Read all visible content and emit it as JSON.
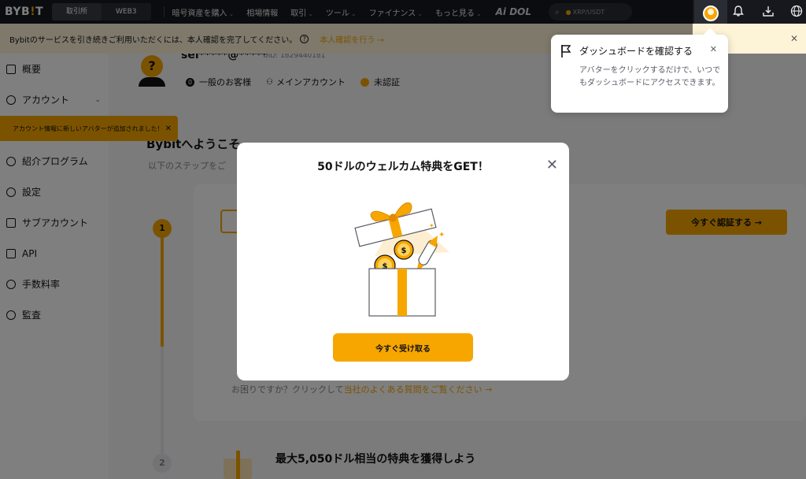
{
  "nav": {
    "logo_prefix": "BYB",
    "logo_i": "!",
    "logo_suffix": "T",
    "tabs": [
      "取引所",
      "WEB3"
    ],
    "menu": [
      "暗号資産を購入",
      "相場情報",
      "取引",
      "ツール",
      "ファイナンス",
      "もっと見る"
    ],
    "aidol": "Ai DOL",
    "search_placeholder": "XRP/USDT"
  },
  "banner": {
    "text": "Bybitのサービスを引き続きご利用いただくには、本人確認を完了してください。",
    "help": "?",
    "link": "本人確認を行う →",
    "close": "✕"
  },
  "sidebar": {
    "items": [
      "概要",
      "アカウント",
      "紹介プログラム",
      "設定",
      "サブアカウント",
      "API",
      "手数料率",
      "監査"
    ]
  },
  "notice": {
    "text": "アカウント情報に新しいアバターが追加されました！",
    "close": "✕"
  },
  "profile": {
    "username": "sei*****@*****",
    "uid": "UID: 1829440181",
    "avatar_letter": "?",
    "level_badge": "0",
    "level": "一般のお客様",
    "account_type": "メインアカウント",
    "kyc_status": "未認証"
  },
  "welcome": {
    "title": "Bybitへようこそ",
    "subtitle": "以下のステップをご"
  },
  "steps": {
    "one": "1",
    "two": "2",
    "verify_button": "今すぐ認証する →",
    "help_text": "お困りですか？クリックして",
    "help_link": "当社のよくある質問をご覧ください →",
    "reward_title": "最大5,050ドル相当の特典を獲得しよう"
  },
  "modal": {
    "title": "50ドルのウェルカム特典をGET！",
    "close": "✕",
    "cta": "今すぐ受け取る",
    "coin_symbol": "$"
  },
  "tooltip": {
    "title": "ダッシュボードを確認する",
    "close": "✕",
    "description": "アバターをクリックするだけで、いつでもダッシュボードにアクセスできます。"
  },
  "colors": {
    "brand": "#f7a600",
    "nav_bg": "#17181e",
    "banner_bg": "#fdf3d7"
  }
}
